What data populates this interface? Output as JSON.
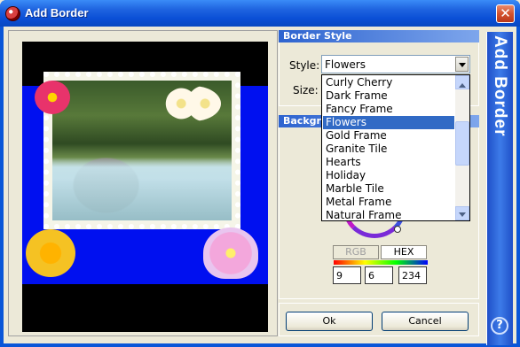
{
  "window": {
    "title": "Add Border",
    "close_glyph": "✕"
  },
  "border_style": {
    "header": "Border Style",
    "style_label": "Style:",
    "style_value": "Flowers",
    "size_label": "Size:"
  },
  "dropdown": {
    "items": [
      "Curly Cherry",
      "Dark Frame",
      "Fancy Frame",
      "Flowers",
      "Gold Frame",
      "Granite Tile",
      "Hearts",
      "Holiday",
      "Marble Tile",
      "Metal Frame",
      "Natural Frame"
    ],
    "selected_index": 3
  },
  "background": {
    "header": "Backgro",
    "rgb_label": "RGB",
    "hex_label": "HEX",
    "r": "9",
    "g": "6",
    "b": "234"
  },
  "buttons": {
    "ok": "Ok",
    "cancel": "Cancel"
  },
  "side": {
    "title": "Add Border",
    "help": "?"
  },
  "colors": {
    "border_bg": "#0010f0",
    "selection": "#316ac5"
  }
}
